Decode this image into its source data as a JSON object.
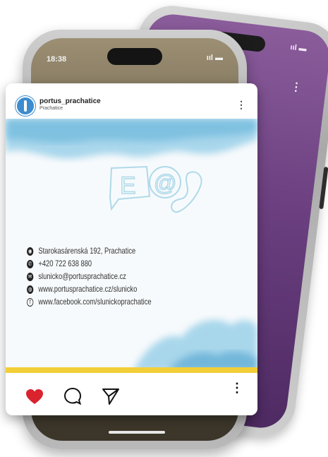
{
  "back_phone": {
    "signal_text": "ııl ▬",
    "menu_text": "⋮"
  },
  "front_phone": {
    "time": "18:38",
    "signal_text": "ııl ▬"
  },
  "post": {
    "username": "portus_prachatice",
    "location": "Prachatice",
    "menu_text": "⋮",
    "contacts": [
      {
        "icon": "location-icon",
        "glyph": "◉",
        "text": "Starokasárenská 192, Prachatice"
      },
      {
        "icon": "phone-icon",
        "glyph": "✆",
        "text": "+420 722 638 880"
      },
      {
        "icon": "email-icon",
        "glyph": "✉",
        "text": "slunicko@portusprachatice.cz"
      },
      {
        "icon": "web-icon",
        "glyph": "◍",
        "text": "www.portusprachatice.cz/slunicko"
      },
      {
        "icon": "facebook-icon",
        "glyph": "f",
        "text": "www.facebook.com/slunickoprachatice"
      }
    ]
  },
  "actions": {
    "more_text": "⋮"
  },
  "colors": {
    "accent_yellow": "#f2cf38",
    "heart_red": "#d9232e",
    "watercolor_blue": "#8ecbe6",
    "back_screen_purple": "#6b3f80"
  }
}
